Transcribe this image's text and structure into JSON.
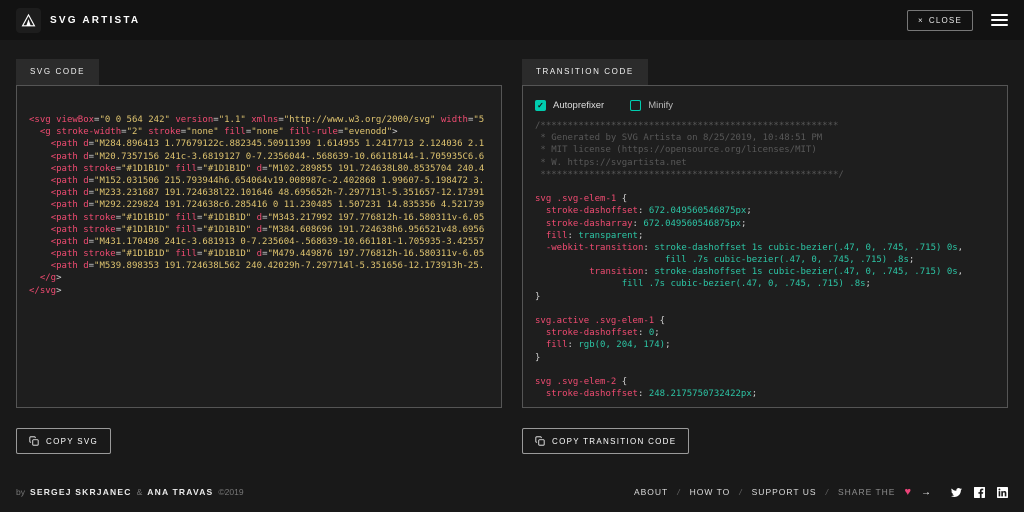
{
  "header": {
    "app_name": "SVG ARTISTA",
    "close_icon": "×",
    "close_label": "CLOSE"
  },
  "left_panel": {
    "tab": "SVG CODE",
    "copy_label": "COPY SVG"
  },
  "right_panel": {
    "tab": "TRANSITION CODE",
    "autoprefixer_label": "Autoprefixer",
    "autoprefixer_checked": true,
    "minify_label": "Minify",
    "minify_checked": false,
    "copy_label": "COPY TRANSITION CODE"
  },
  "colors": {
    "accent_teal": "#00ccae",
    "accent_pink": "#ec4379",
    "string_yellow": "#dfc46f"
  },
  "svg_code_lines": [
    [
      [
        "tag",
        "<svg"
      ],
      [
        "txt",
        " "
      ],
      [
        "att",
        "viewBox"
      ],
      [
        "pun",
        "="
      ],
      [
        "str",
        "\"0 0 564 242\""
      ],
      [
        "txt",
        " "
      ],
      [
        "att",
        "version"
      ],
      [
        "pun",
        "="
      ],
      [
        "str",
        "\"1.1\""
      ],
      [
        "txt",
        " "
      ],
      [
        "att",
        "xmlns"
      ],
      [
        "pun",
        "="
      ],
      [
        "str",
        "\"http://www.w3.org/2000/svg\""
      ],
      [
        "txt",
        " "
      ],
      [
        "att",
        "width"
      ],
      [
        "pun",
        "="
      ],
      [
        "str",
        "\"5"
      ]
    ],
    [
      [
        "txt",
        "  "
      ],
      [
        "tag",
        "<g"
      ],
      [
        "txt",
        " "
      ],
      [
        "att",
        "stroke-width"
      ],
      [
        "pun",
        "="
      ],
      [
        "str",
        "\"2\""
      ],
      [
        "txt",
        " "
      ],
      [
        "att",
        "stroke"
      ],
      [
        "pun",
        "="
      ],
      [
        "str",
        "\"none\""
      ],
      [
        "txt",
        " "
      ],
      [
        "att",
        "fill"
      ],
      [
        "pun",
        "="
      ],
      [
        "str",
        "\"none\""
      ],
      [
        "txt",
        " "
      ],
      [
        "att",
        "fill-rule"
      ],
      [
        "pun",
        "="
      ],
      [
        "str",
        "\"evenodd\""
      ],
      [
        "pun",
        ">"
      ]
    ],
    [
      [
        "txt",
        "    "
      ],
      [
        "tag",
        "<path"
      ],
      [
        "txt",
        " "
      ],
      [
        "att",
        "d"
      ],
      [
        "pun",
        "="
      ],
      [
        "str",
        "\"M284.896413 1.77679122c.882345.50911399 1.614955 1.2417713 2.124036 2.1"
      ]
    ],
    [
      [
        "txt",
        "    "
      ],
      [
        "tag",
        "<path"
      ],
      [
        "txt",
        " "
      ],
      [
        "att",
        "d"
      ],
      [
        "pun",
        "="
      ],
      [
        "str",
        "\"M20.7357156 241c-3.6819127 0-7.2356044-.568639-10.66118144-1.705935C6.6"
      ]
    ],
    [
      [
        "txt",
        "    "
      ],
      [
        "tag",
        "<path"
      ],
      [
        "txt",
        " "
      ],
      [
        "att",
        "stroke"
      ],
      [
        "pun",
        "="
      ],
      [
        "str",
        "\"#1D1B1D\""
      ],
      [
        "txt",
        " "
      ],
      [
        "att",
        "fill"
      ],
      [
        "pun",
        "="
      ],
      [
        "str",
        "\"#1D1B1D\""
      ],
      [
        "txt",
        " "
      ],
      [
        "att",
        "d"
      ],
      [
        "pun",
        "="
      ],
      [
        "str",
        "\"M102.289855 191.724638L80.8535704 240.4"
      ]
    ],
    [
      [
        "txt",
        "    "
      ],
      [
        "tag",
        "<path"
      ],
      [
        "txt",
        " "
      ],
      [
        "att",
        "d"
      ],
      [
        "pun",
        "="
      ],
      [
        "str",
        "\"M152.031506 215.793944h6.654064v19.008987c-2.402868 1.99607-5.198472 3."
      ]
    ],
    [
      [
        "txt",
        "    "
      ],
      [
        "tag",
        "<path"
      ],
      [
        "txt",
        " "
      ],
      [
        "att",
        "d"
      ],
      [
        "pun",
        "="
      ],
      [
        "str",
        "\"M233.231687 191.724638l22.101646 48.695652h-7.297713l-5.351657-12.17391"
      ]
    ],
    [
      [
        "txt",
        "    "
      ],
      [
        "tag",
        "<path"
      ],
      [
        "txt",
        " "
      ],
      [
        "att",
        "d"
      ],
      [
        "pun",
        "="
      ],
      [
        "str",
        "\"M292.229824 191.724638c6.285416 0 11.230485 1.507231 14.835356 4.521739"
      ]
    ],
    [
      [
        "txt",
        "    "
      ],
      [
        "tag",
        "<path"
      ],
      [
        "txt",
        " "
      ],
      [
        "att",
        "stroke"
      ],
      [
        "pun",
        "="
      ],
      [
        "str",
        "\"#1D1B1D\""
      ],
      [
        "txt",
        " "
      ],
      [
        "att",
        "fill"
      ],
      [
        "pun",
        "="
      ],
      [
        "str",
        "\"#1D1B1D\""
      ],
      [
        "txt",
        " "
      ],
      [
        "att",
        "d"
      ],
      [
        "pun",
        "="
      ],
      [
        "str",
        "\"M343.217992 197.776812h-16.580311v-6.05"
      ]
    ],
    [
      [
        "txt",
        "    "
      ],
      [
        "tag",
        "<path"
      ],
      [
        "txt",
        " "
      ],
      [
        "att",
        "stroke"
      ],
      [
        "pun",
        "="
      ],
      [
        "str",
        "\"#1D1B1D\""
      ],
      [
        "txt",
        " "
      ],
      [
        "att",
        "fill"
      ],
      [
        "pun",
        "="
      ],
      [
        "str",
        "\"#1D1B1D\""
      ],
      [
        "txt",
        " "
      ],
      [
        "att",
        "d"
      ],
      [
        "pun",
        "="
      ],
      [
        "str",
        "\"M384.608696 191.724638h6.956521v48.6956"
      ]
    ],
    [
      [
        "txt",
        "    "
      ],
      [
        "tag",
        "<path"
      ],
      [
        "txt",
        " "
      ],
      [
        "att",
        "d"
      ],
      [
        "pun",
        "="
      ],
      [
        "str",
        "\"M431.170498 241c-3.681913 0-7.235604-.568639-10.661181-1.705935-3.42557"
      ]
    ],
    [
      [
        "txt",
        "    "
      ],
      [
        "tag",
        "<path"
      ],
      [
        "txt",
        " "
      ],
      [
        "att",
        "stroke"
      ],
      [
        "pun",
        "="
      ],
      [
        "str",
        "\"#1D1B1D\""
      ],
      [
        "txt",
        " "
      ],
      [
        "att",
        "fill"
      ],
      [
        "pun",
        "="
      ],
      [
        "str",
        "\"#1D1B1D\""
      ],
      [
        "txt",
        " "
      ],
      [
        "att",
        "d"
      ],
      [
        "pun",
        "="
      ],
      [
        "str",
        "\"M479.449876 197.776812h-16.580311v-6.05"
      ]
    ],
    [
      [
        "txt",
        "    "
      ],
      [
        "tag",
        "<path"
      ],
      [
        "txt",
        " "
      ],
      [
        "att",
        "d"
      ],
      [
        "pun",
        "="
      ],
      [
        "str",
        "\"M539.898353 191.724638L562 240.42029h-7.297714l-5.351656-12.173913h-25."
      ]
    ],
    [
      [
        "txt",
        "  "
      ],
      [
        "tag",
        "</g"
      ],
      [
        "pun",
        ">"
      ]
    ],
    [
      [
        "tag",
        "</svg"
      ],
      [
        "pun",
        ">"
      ]
    ]
  ],
  "css_code_lines": [
    [
      [
        "com",
        "/*******************************************************"
      ]
    ],
    [
      [
        "com",
        " * Generated by SVG Artista on 8/25/2019, 10:48:51 PM"
      ]
    ],
    [
      [
        "com",
        " * MIT license (https://opensource.org/licenses/MIT)"
      ]
    ],
    [
      [
        "com",
        " * W. https://svgartista.net"
      ]
    ],
    [
      [
        "com",
        " *******************************************************/"
      ]
    ],
    [],
    [
      [
        "sel",
        "svg .svg-elem-1"
      ],
      [
        "txt",
        " "
      ],
      [
        "pun",
        "{"
      ]
    ],
    [
      [
        "txt",
        "  "
      ],
      [
        "prp",
        "stroke-dashoffset"
      ],
      [
        "pun",
        ":"
      ],
      [
        "txt",
        " "
      ],
      [
        "val",
        "672.049560546875px"
      ],
      [
        "pun",
        ";"
      ]
    ],
    [
      [
        "txt",
        "  "
      ],
      [
        "prp",
        "stroke-dasharray"
      ],
      [
        "pun",
        ":"
      ],
      [
        "txt",
        " "
      ],
      [
        "val",
        "672.049560546875px"
      ],
      [
        "pun",
        ";"
      ]
    ],
    [
      [
        "txt",
        "  "
      ],
      [
        "prp",
        "fill"
      ],
      [
        "pun",
        ":"
      ],
      [
        "txt",
        " "
      ],
      [
        "val",
        "transparent"
      ],
      [
        "pun",
        ";"
      ]
    ],
    [
      [
        "txt",
        "  "
      ],
      [
        "prp",
        "-webkit-transition"
      ],
      [
        "pun",
        ":"
      ],
      [
        "txt",
        " "
      ],
      [
        "val",
        "stroke-dashoffset 1s cubic-bezier(.47, 0, .745, .715) 0s"
      ],
      [
        "pun",
        ","
      ]
    ],
    [
      [
        "txt",
        "                        "
      ],
      [
        "val",
        "fill .7s cubic-bezier(.47, 0, .745, .715) .8s"
      ],
      [
        "pun",
        ";"
      ]
    ],
    [
      [
        "txt",
        "          "
      ],
      [
        "prp",
        "transition"
      ],
      [
        "pun",
        ":"
      ],
      [
        "txt",
        " "
      ],
      [
        "val",
        "stroke-dashoffset 1s cubic-bezier(.47, 0, .745, .715) 0s"
      ],
      [
        "pun",
        ","
      ]
    ],
    [
      [
        "txt",
        "                "
      ],
      [
        "val",
        "fill .7s cubic-bezier(.47, 0, .745, .715) .8s"
      ],
      [
        "pun",
        ";"
      ]
    ],
    [
      [
        "pun",
        "}"
      ]
    ],
    [],
    [
      [
        "sel",
        "svg.active .svg-elem-1"
      ],
      [
        "txt",
        " "
      ],
      [
        "pun",
        "{"
      ]
    ],
    [
      [
        "txt",
        "  "
      ],
      [
        "prp",
        "stroke-dashoffset"
      ],
      [
        "pun",
        ":"
      ],
      [
        "txt",
        " "
      ],
      [
        "val",
        "0"
      ],
      [
        "pun",
        ";"
      ]
    ],
    [
      [
        "txt",
        "  "
      ],
      [
        "prp",
        "fill"
      ],
      [
        "pun",
        ":"
      ],
      [
        "txt",
        " "
      ],
      [
        "val",
        "rgb(0, 204, 174)"
      ],
      [
        "pun",
        ";"
      ]
    ],
    [
      [
        "pun",
        "}"
      ]
    ],
    [],
    [
      [
        "sel",
        "svg .svg-elem-2"
      ],
      [
        "txt",
        " "
      ],
      [
        "pun",
        "{"
      ]
    ],
    [
      [
        "txt",
        "  "
      ],
      [
        "prp",
        "stroke-dashoffset"
      ],
      [
        "pun",
        ":"
      ],
      [
        "txt",
        " "
      ],
      [
        "val",
        "248.2175750732422px"
      ],
      [
        "pun",
        ";"
      ]
    ]
  ],
  "footer": {
    "by": "by",
    "author1": "SERGEJ SKRJANEC",
    "amp": "&",
    "author2": "ANA TRAVAS",
    "year": "©2019",
    "links": [
      "ABOUT",
      "HOW TO",
      "SUPPORT US"
    ],
    "separator": "/",
    "share_label": "SHARE THE",
    "heart": "♥",
    "arrow": "→"
  }
}
